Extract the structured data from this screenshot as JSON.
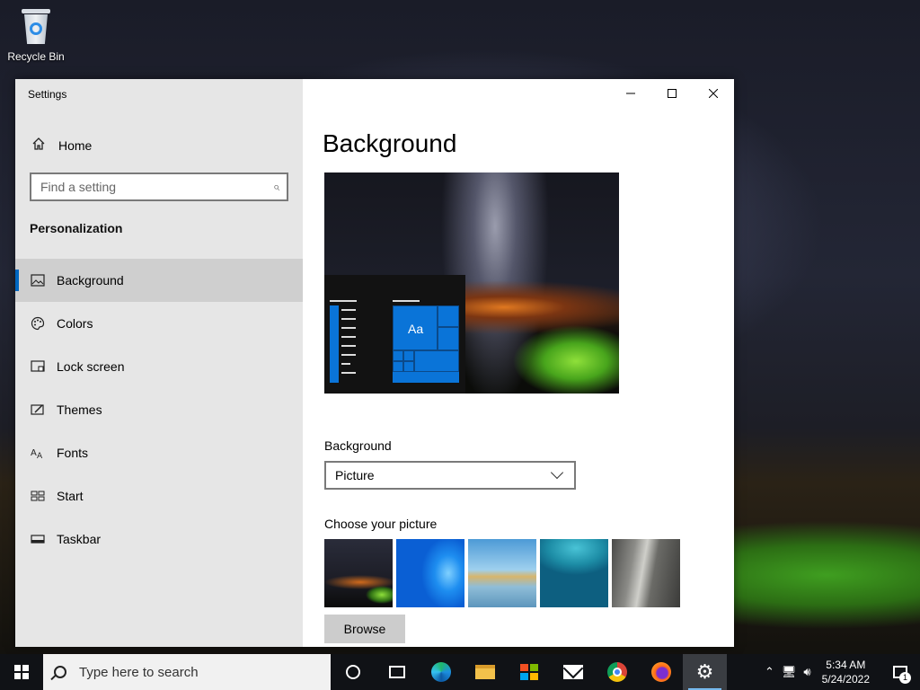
{
  "desktop": {
    "recycle_bin_label": "Recycle Bin"
  },
  "window": {
    "title": "Settings",
    "minimize_icon": "minimize-icon",
    "maximize_icon": "maximize-icon",
    "close_icon": "close-icon"
  },
  "sidebar": {
    "home_label": "Home",
    "search_placeholder": "Find a setting",
    "section_title": "Personalization",
    "items": [
      {
        "label": "Background",
        "icon": "picture-icon",
        "active": true
      },
      {
        "label": "Colors",
        "icon": "palette-icon",
        "active": false
      },
      {
        "label": "Lock screen",
        "icon": "lock-screen-icon",
        "active": false
      },
      {
        "label": "Themes",
        "icon": "themes-brush-icon",
        "active": false
      },
      {
        "label": "Fonts",
        "icon": "fonts-icon",
        "active": false
      },
      {
        "label": "Start",
        "icon": "start-grid-icon",
        "active": false
      },
      {
        "label": "Taskbar",
        "icon": "taskbar-icon",
        "active": false
      }
    ]
  },
  "main": {
    "page_title": "Background",
    "preview_tile_text": "Aa",
    "background_label": "Background",
    "background_value": "Picture",
    "choose_label": "Choose your picture",
    "browse_label": "Browse"
  },
  "taskbar": {
    "search_placeholder": "Type here to search",
    "time": "5:34 AM",
    "date": "5/24/2022",
    "notification_count": "1",
    "accent": "#0067c0"
  }
}
